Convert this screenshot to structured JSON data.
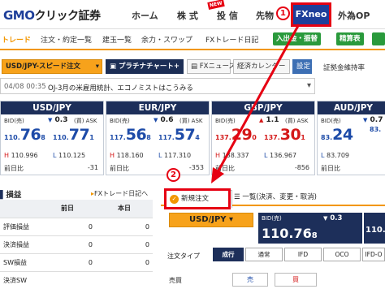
{
  "header": {
    "logo": "GMO",
    "logo_ja": "クリック証券",
    "nav": [
      {
        "label": "ホーム"
      },
      {
        "label": "株 式"
      },
      {
        "label": "投 信"
      },
      {
        "label": "先物"
      }
    ],
    "new_badge": "NEW",
    "fxneo": "FXneo",
    "gaibai": "外為OP"
  },
  "subnav": {
    "items": [
      {
        "label": "トレード"
      },
      {
        "label": "注文・約定一覧"
      },
      {
        "label": "建玉一覧"
      },
      {
        "label": "余力・スワップ"
      },
      {
        "label": "FXトレード日記"
      }
    ],
    "deposit": "入出金・振替",
    "report": "精算表"
  },
  "toolbar": {
    "pair_order": "USD/JPY-スピード注文",
    "platinum": "プラチナチャート+",
    "news": "FXニュース",
    "calendar": "経済カレンダー",
    "settings": "設定",
    "margin": "証拠金維持率"
  },
  "news": {
    "time": "04/08 00:35",
    "headline": "OJ-3月の米雇用統計、エコノミストはこうみる"
  },
  "panels": [
    {
      "pair": "USD/JPY",
      "bid_label": "BID(売)",
      "spread": "0.3",
      "ask_label": "(買) ASK",
      "bid_small": "110.",
      "bid_big": "76",
      "bid_last": "8",
      "ask_small": "110.",
      "ask_big": "77",
      "ask_last": "1",
      "high": "110.996",
      "low": "110.125",
      "chg_label": "前日比",
      "chg": "-31"
    },
    {
      "pair": "EUR/JPY",
      "bid_label": "BID(売)",
      "spread": "0.6",
      "ask_label": "(買) ASK",
      "bid_small": "117.",
      "bid_big": "56",
      "bid_last": "8",
      "ask_small": "117.",
      "ask_big": "57",
      "ask_last": "4",
      "high": "118.160",
      "low": "117.310",
      "chg_label": "前日比",
      "chg": "-353"
    },
    {
      "pair": "GBP/JPY",
      "bid_label": "BID(売)",
      "spread": "1.1",
      "ask_label": "(買) ASK",
      "bid_small": "137.",
      "bid_big": "29",
      "bid_last": "0",
      "ask_small": "137.",
      "ask_big": "30",
      "ask_last": "1",
      "high": "138.337",
      "low": "136.967",
      "chg_label": "前日比",
      "chg": "-856"
    },
    {
      "pair": "AUD/JPY",
      "bid_label": "BID(売)",
      "spread": "0.7",
      "ask_label": "(買) ASK",
      "bid_small": "83.",
      "bid_big": "24",
      "bid_last": "",
      "ask_small": "83.",
      "ask_big": "",
      "ask_last": "",
      "high": "",
      "low": "83.709",
      "chg_label": "前日比",
      "chg": ""
    }
  ],
  "profit": {
    "title": "損益",
    "diary_link": "FXトレード日記へ",
    "col_prev": "前日",
    "col_today": "本日",
    "rows": [
      {
        "label": "評価損益",
        "prev": "0",
        "today": "0"
      },
      {
        "label": "決済損益",
        "prev": "0",
        "today": "0"
      },
      {
        "label": "SW損益",
        "prev": "0",
        "today": "0"
      },
      {
        "label": "決済SW",
        "prev": "",
        "today": ""
      }
    ]
  },
  "order": {
    "tab_new": "新規注文",
    "tab_list": "一覧(決済、変更・取消)",
    "pair": "USD/JPY",
    "quote_bid_label": "BID(売)",
    "quote_spread": "0.3",
    "quote_bid": "110.76",
    "quote_bid_last": "8",
    "quote_ask": "110.",
    "type_label": "注文タイプ",
    "types": [
      "成行",
      "通常",
      "IFD",
      "OCO",
      "IFD-O"
    ],
    "side_label": "売買",
    "sell": "売",
    "buy": "買"
  },
  "callouts": {
    "one": "1",
    "two": "2"
  },
  "colors": {
    "navy": "#1d2f5a",
    "orange": "#f29600",
    "red": "#e60012",
    "bid_blue": "#1d4ba8"
  }
}
